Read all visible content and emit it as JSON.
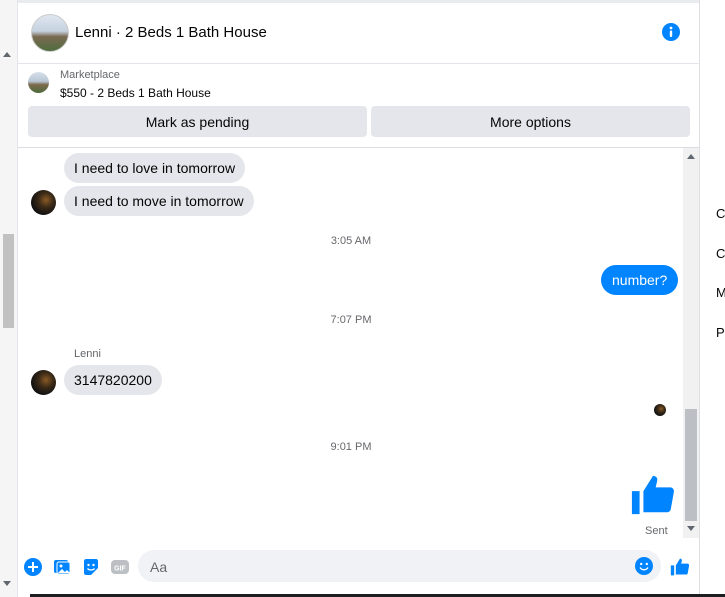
{
  "header": {
    "title": "Lenni · 2 Beds 1 Bath House"
  },
  "marketplace": {
    "label": "Marketplace",
    "listing": "$550 - 2 Beds 1 Bath House",
    "pending_label": "Mark as pending",
    "more_label": "More options"
  },
  "messages": {
    "items": [
      {
        "text": "I need to love in tomorrow",
        "direction": "in"
      },
      {
        "text": "I need to move in tomorrow",
        "direction": "in"
      },
      {
        "text": "number?",
        "direction": "out"
      },
      {
        "text": "3147820200",
        "direction": "in"
      }
    ],
    "timestamps": [
      "3:05 AM",
      "7:07 PM",
      "9:01 PM"
    ],
    "sender_name": "Lenni",
    "status": "Sent"
  },
  "composer": {
    "placeholder": "Aa"
  },
  "right_column": {
    "letters": [
      "C",
      "C",
      "M",
      "P"
    ]
  },
  "colors": {
    "accent": "#0084ff",
    "bubble_in": "#e4e6eb"
  }
}
